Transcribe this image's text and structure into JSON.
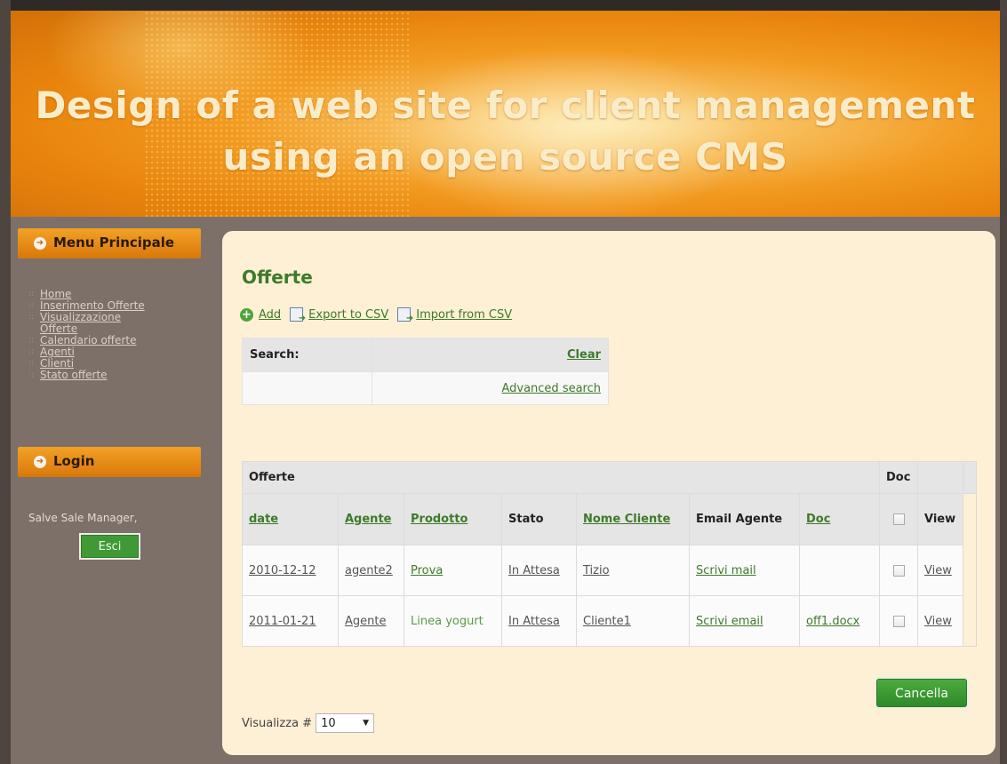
{
  "banner": {
    "title_line1": "Design of a web site for client management",
    "title_line2": "using an open source CMS"
  },
  "sidebar": {
    "menu_title": "Menu Principale",
    "items": [
      {
        "label": "Home"
      },
      {
        "label": "Inserimento Offerte"
      },
      {
        "label": "Visualizzazione"
      },
      {
        "label": "Offerte"
      },
      {
        "label": "Calendario offerte"
      },
      {
        "label": "Agenti"
      },
      {
        "label": "Clienti"
      },
      {
        "label": "Stato offerte"
      }
    ],
    "login_title": "Login",
    "greeting": "Salve Sale Manager,",
    "logout_label": "Esci"
  },
  "main": {
    "title": "Offerte",
    "actions": {
      "add": "Add",
      "export": "Export to CSV",
      "import": "Import from CSV"
    },
    "search": {
      "label": "Search:",
      "clear": "Clear",
      "advanced": "Advanced search"
    },
    "table": {
      "group_header": "Offerte",
      "group_doc": "Doc",
      "columns": {
        "date": "date",
        "agente": "Agente",
        "prodotto": "Prodotto",
        "stato": "Stato",
        "nome_cliente": "Nome Cliente",
        "email_agente": "Email Agente",
        "doc": "Doc",
        "view": "View"
      },
      "rows": [
        {
          "date": "2010-12-12",
          "agente": "agente2",
          "prodotto": "Prova",
          "stato": "In Attesa",
          "cliente": "Tizio",
          "email": "Scrivi mail",
          "doc": "",
          "view": "View"
        },
        {
          "date": "2011-01-21",
          "agente": "Agente",
          "prodotto": "Linea yogurt",
          "stato": "In Attesa",
          "cliente": "Cliente1",
          "email": "Scrivi email",
          "doc": "off1.docx",
          "view": "View"
        }
      ]
    },
    "cancel_label": "Cancella",
    "page_size_label": "Visualizza #",
    "page_size_value": "10"
  },
  "colors": {
    "accent_green": "#3e7a2a",
    "banner_orange": "#f29a20",
    "panel_bg": "#fdf0d5",
    "frame_bg": "#7d7068"
  }
}
